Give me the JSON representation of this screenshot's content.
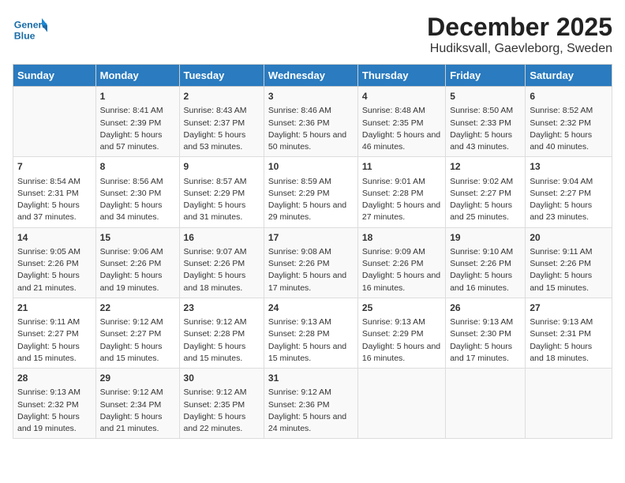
{
  "logo": {
    "text_general": "General",
    "text_blue": "Blue"
  },
  "header": {
    "month": "December 2025",
    "location": "Hudiksvall, Gaevleborg, Sweden"
  },
  "days_of_week": [
    "Sunday",
    "Monday",
    "Tuesday",
    "Wednesday",
    "Thursday",
    "Friday",
    "Saturday"
  ],
  "weeks": [
    [
      {
        "day": "",
        "sunrise": "",
        "sunset": "",
        "daylight": ""
      },
      {
        "day": "1",
        "sunrise": "Sunrise: 8:41 AM",
        "sunset": "Sunset: 2:39 PM",
        "daylight": "Daylight: 5 hours and 57 minutes."
      },
      {
        "day": "2",
        "sunrise": "Sunrise: 8:43 AM",
        "sunset": "Sunset: 2:37 PM",
        "daylight": "Daylight: 5 hours and 53 minutes."
      },
      {
        "day": "3",
        "sunrise": "Sunrise: 8:46 AM",
        "sunset": "Sunset: 2:36 PM",
        "daylight": "Daylight: 5 hours and 50 minutes."
      },
      {
        "day": "4",
        "sunrise": "Sunrise: 8:48 AM",
        "sunset": "Sunset: 2:35 PM",
        "daylight": "Daylight: 5 hours and 46 minutes."
      },
      {
        "day": "5",
        "sunrise": "Sunrise: 8:50 AM",
        "sunset": "Sunset: 2:33 PM",
        "daylight": "Daylight: 5 hours and 43 minutes."
      },
      {
        "day": "6",
        "sunrise": "Sunrise: 8:52 AM",
        "sunset": "Sunset: 2:32 PM",
        "daylight": "Daylight: 5 hours and 40 minutes."
      }
    ],
    [
      {
        "day": "7",
        "sunrise": "Sunrise: 8:54 AM",
        "sunset": "Sunset: 2:31 PM",
        "daylight": "Daylight: 5 hours and 37 minutes."
      },
      {
        "day": "8",
        "sunrise": "Sunrise: 8:56 AM",
        "sunset": "Sunset: 2:30 PM",
        "daylight": "Daylight: 5 hours and 34 minutes."
      },
      {
        "day": "9",
        "sunrise": "Sunrise: 8:57 AM",
        "sunset": "Sunset: 2:29 PM",
        "daylight": "Daylight: 5 hours and 31 minutes."
      },
      {
        "day": "10",
        "sunrise": "Sunrise: 8:59 AM",
        "sunset": "Sunset: 2:29 PM",
        "daylight": "Daylight: 5 hours and 29 minutes."
      },
      {
        "day": "11",
        "sunrise": "Sunrise: 9:01 AM",
        "sunset": "Sunset: 2:28 PM",
        "daylight": "Daylight: 5 hours and 27 minutes."
      },
      {
        "day": "12",
        "sunrise": "Sunrise: 9:02 AM",
        "sunset": "Sunset: 2:27 PM",
        "daylight": "Daylight: 5 hours and 25 minutes."
      },
      {
        "day": "13",
        "sunrise": "Sunrise: 9:04 AM",
        "sunset": "Sunset: 2:27 PM",
        "daylight": "Daylight: 5 hours and 23 minutes."
      }
    ],
    [
      {
        "day": "14",
        "sunrise": "Sunrise: 9:05 AM",
        "sunset": "Sunset: 2:26 PM",
        "daylight": "Daylight: 5 hours and 21 minutes."
      },
      {
        "day": "15",
        "sunrise": "Sunrise: 9:06 AM",
        "sunset": "Sunset: 2:26 PM",
        "daylight": "Daylight: 5 hours and 19 minutes."
      },
      {
        "day": "16",
        "sunrise": "Sunrise: 9:07 AM",
        "sunset": "Sunset: 2:26 PM",
        "daylight": "Daylight: 5 hours and 18 minutes."
      },
      {
        "day": "17",
        "sunrise": "Sunrise: 9:08 AM",
        "sunset": "Sunset: 2:26 PM",
        "daylight": "Daylight: 5 hours and 17 minutes."
      },
      {
        "day": "18",
        "sunrise": "Sunrise: 9:09 AM",
        "sunset": "Sunset: 2:26 PM",
        "daylight": "Daylight: 5 hours and 16 minutes."
      },
      {
        "day": "19",
        "sunrise": "Sunrise: 9:10 AM",
        "sunset": "Sunset: 2:26 PM",
        "daylight": "Daylight: 5 hours and 16 minutes."
      },
      {
        "day": "20",
        "sunrise": "Sunrise: 9:11 AM",
        "sunset": "Sunset: 2:26 PM",
        "daylight": "Daylight: 5 hours and 15 minutes."
      }
    ],
    [
      {
        "day": "21",
        "sunrise": "Sunrise: 9:11 AM",
        "sunset": "Sunset: 2:27 PM",
        "daylight": "Daylight: 5 hours and 15 minutes."
      },
      {
        "day": "22",
        "sunrise": "Sunrise: 9:12 AM",
        "sunset": "Sunset: 2:27 PM",
        "daylight": "Daylight: 5 hours and 15 minutes."
      },
      {
        "day": "23",
        "sunrise": "Sunrise: 9:12 AM",
        "sunset": "Sunset: 2:28 PM",
        "daylight": "Daylight: 5 hours and 15 minutes."
      },
      {
        "day": "24",
        "sunrise": "Sunrise: 9:13 AM",
        "sunset": "Sunset: 2:28 PM",
        "daylight": "Daylight: 5 hours and 15 minutes."
      },
      {
        "day": "25",
        "sunrise": "Sunrise: 9:13 AM",
        "sunset": "Sunset: 2:29 PM",
        "daylight": "Daylight: 5 hours and 16 minutes."
      },
      {
        "day": "26",
        "sunrise": "Sunrise: 9:13 AM",
        "sunset": "Sunset: 2:30 PM",
        "daylight": "Daylight: 5 hours and 17 minutes."
      },
      {
        "day": "27",
        "sunrise": "Sunrise: 9:13 AM",
        "sunset": "Sunset: 2:31 PM",
        "daylight": "Daylight: 5 hours and 18 minutes."
      }
    ],
    [
      {
        "day": "28",
        "sunrise": "Sunrise: 9:13 AM",
        "sunset": "Sunset: 2:32 PM",
        "daylight": "Daylight: 5 hours and 19 minutes."
      },
      {
        "day": "29",
        "sunrise": "Sunrise: 9:12 AM",
        "sunset": "Sunset: 2:34 PM",
        "daylight": "Daylight: 5 hours and 21 minutes."
      },
      {
        "day": "30",
        "sunrise": "Sunrise: 9:12 AM",
        "sunset": "Sunset: 2:35 PM",
        "daylight": "Daylight: 5 hours and 22 minutes."
      },
      {
        "day": "31",
        "sunrise": "Sunrise: 9:12 AM",
        "sunset": "Sunset: 2:36 PM",
        "daylight": "Daylight: 5 hours and 24 minutes."
      },
      {
        "day": "",
        "sunrise": "",
        "sunset": "",
        "daylight": ""
      },
      {
        "day": "",
        "sunrise": "",
        "sunset": "",
        "daylight": ""
      },
      {
        "day": "",
        "sunrise": "",
        "sunset": "",
        "daylight": ""
      }
    ]
  ]
}
